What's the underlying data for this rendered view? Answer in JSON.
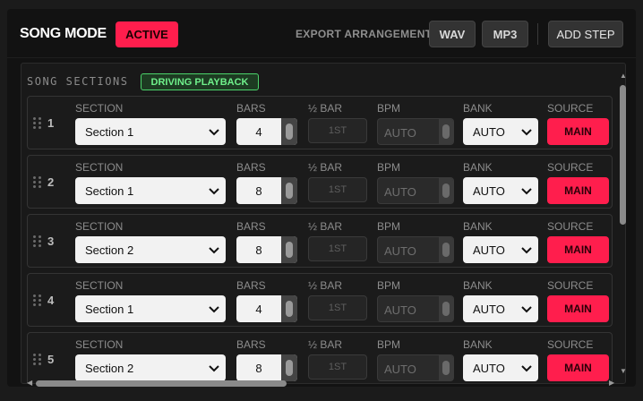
{
  "header": {
    "title": "SONG MODE",
    "status_badge": "ACTIVE",
    "export_label": "EXPORT ARRANGEMENT",
    "wav_label": "WAV",
    "mp3_label": "MP3",
    "add_step_label": "ADD STEP"
  },
  "panel": {
    "title": "SONG SECTIONS",
    "badge": "DRIVING PLAYBACK"
  },
  "columns": {
    "section": "SECTION",
    "bars": "BARS",
    "half_bar": "½ BAR",
    "bpm": "BPM",
    "bank": "BANK",
    "source": "SOURCE"
  },
  "rows": [
    {
      "num": "1",
      "section": "Section 1",
      "bars": "4",
      "half_bar": "1ST",
      "bpm_placeholder": "AUTO",
      "bank": "AUTO",
      "source": "MAIN"
    },
    {
      "num": "2",
      "section": "Section 1",
      "bars": "8",
      "half_bar": "1ST",
      "bpm_placeholder": "AUTO",
      "bank": "AUTO",
      "source": "MAIN"
    },
    {
      "num": "3",
      "section": "Section 2",
      "bars": "8",
      "half_bar": "1ST",
      "bpm_placeholder": "AUTO",
      "bank": "AUTO",
      "source": "MAIN"
    },
    {
      "num": "4",
      "section": "Section 1",
      "bars": "4",
      "half_bar": "1ST",
      "bpm_placeholder": "AUTO",
      "bank": "AUTO",
      "source": "MAIN"
    },
    {
      "num": "5",
      "section": "Section 2",
      "bars": "8",
      "half_bar": "1ST",
      "bpm_placeholder": "AUTO",
      "bank": "AUTO",
      "source": "MAIN"
    }
  ],
  "colors": {
    "accent": "#ff1e4d",
    "playback_green": "#6ff08b",
    "background": "#121212"
  },
  "icons": {
    "drag": "drag-handle-icon",
    "dropdown": "chevron-down-icon"
  }
}
